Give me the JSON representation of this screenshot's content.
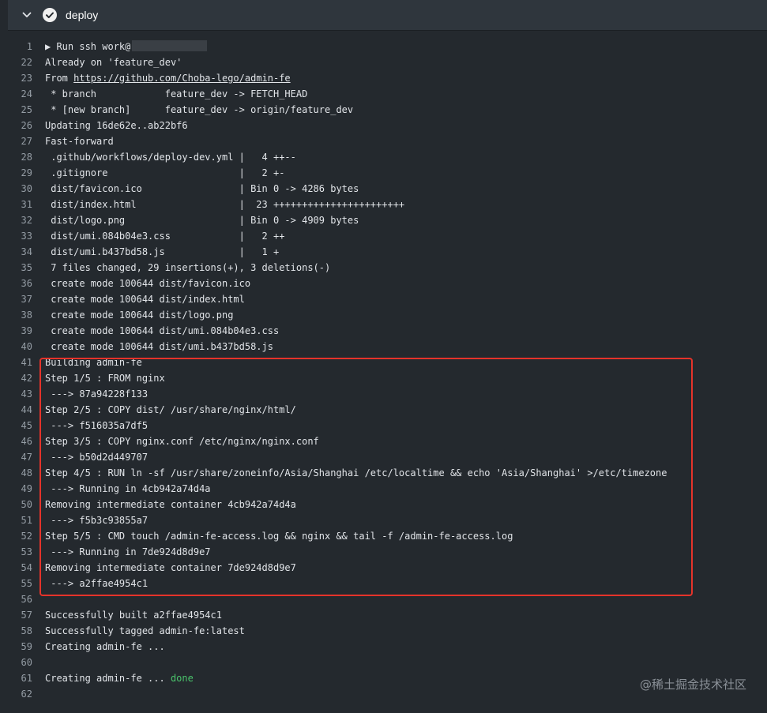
{
  "step": {
    "title": "deploy",
    "expand_icon": "chevron-down-icon",
    "status_icon": "check-circle-icon"
  },
  "lines": [
    {
      "n": "1",
      "t": "▶ Run ssh work@",
      "redacted": true
    },
    {
      "n": "22",
      "t": "Already on 'feature_dev'"
    },
    {
      "n": "23",
      "t": "From ",
      "link": "https://github.com/Choba-lego/admin-fe"
    },
    {
      "n": "24",
      "t": " * branch            feature_dev -> FETCH_HEAD"
    },
    {
      "n": "25",
      "t": " * [new branch]      feature_dev -> origin/feature_dev"
    },
    {
      "n": "26",
      "t": "Updating 16de62e..ab22bf6"
    },
    {
      "n": "27",
      "t": "Fast-forward"
    },
    {
      "n": "28",
      "t": " .github/workflows/deploy-dev.yml |   4 ++--"
    },
    {
      "n": "29",
      "t": " .gitignore                       |   2 +-"
    },
    {
      "n": "30",
      "t": " dist/favicon.ico                 | Bin 0 -> 4286 bytes"
    },
    {
      "n": "31",
      "t": " dist/index.html                  |  23 +++++++++++++++++++++++"
    },
    {
      "n": "32",
      "t": " dist/logo.png                    | Bin 0 -> 4909 bytes"
    },
    {
      "n": "33",
      "t": " dist/umi.084b04e3.css            |   2 ++"
    },
    {
      "n": "34",
      "t": " dist/umi.b437bd58.js             |   1 +"
    },
    {
      "n": "35",
      "t": " 7 files changed, 29 insertions(+), 3 deletions(-)"
    },
    {
      "n": "36",
      "t": " create mode 100644 dist/favicon.ico"
    },
    {
      "n": "37",
      "t": " create mode 100644 dist/index.html"
    },
    {
      "n": "38",
      "t": " create mode 100644 dist/logo.png"
    },
    {
      "n": "39",
      "t": " create mode 100644 dist/umi.084b04e3.css"
    },
    {
      "n": "40",
      "t": " create mode 100644 dist/umi.b437bd58.js"
    },
    {
      "n": "41",
      "t": "Building admin-fe"
    },
    {
      "n": "42",
      "t": "Step 1/5 : FROM nginx"
    },
    {
      "n": "43",
      "t": " ---> 87a94228f133"
    },
    {
      "n": "44",
      "t": "Step 2/5 : COPY dist/ /usr/share/nginx/html/"
    },
    {
      "n": "45",
      "t": " ---> f516035a7df5"
    },
    {
      "n": "46",
      "t": "Step 3/5 : COPY nginx.conf /etc/nginx/nginx.conf"
    },
    {
      "n": "47",
      "t": " ---> b50d2d449707"
    },
    {
      "n": "48",
      "t": "Step 4/5 : RUN ln -sf /usr/share/zoneinfo/Asia/Shanghai /etc/localtime && echo 'Asia/Shanghai' >/etc/timezone"
    },
    {
      "n": "49",
      "t": " ---> Running in 4cb942a74d4a"
    },
    {
      "n": "50",
      "t": "Removing intermediate container 4cb942a74d4a"
    },
    {
      "n": "51",
      "t": " ---> f5b3c93855a7"
    },
    {
      "n": "52",
      "t": "Step 5/5 : CMD touch /admin-fe-access.log && nginx && tail -f /admin-fe-access.log"
    },
    {
      "n": "53",
      "t": " ---> Running in 7de924d8d9e7"
    },
    {
      "n": "54",
      "t": "Removing intermediate container 7de924d8d9e7"
    },
    {
      "n": "55",
      "t": " ---> a2ffae4954c1"
    },
    {
      "n": "56",
      "t": ""
    },
    {
      "n": "57",
      "t": "Successfully built a2ffae4954c1"
    },
    {
      "n": "58",
      "t": "Successfully tagged admin-fe:latest"
    },
    {
      "n": "59",
      "t": "Creating admin-fe ..."
    },
    {
      "n": "60",
      "t": ""
    },
    {
      "n": "61",
      "t": "Creating admin-fe ... ",
      "status": "done"
    },
    {
      "n": "62",
      "t": ""
    }
  ],
  "watermark": "@稀土掘金技术社区",
  "colors": {
    "background": "#24292e",
    "header": "#2f363d",
    "highlight_box": "#e5332a",
    "done": "#4ac26b"
  }
}
